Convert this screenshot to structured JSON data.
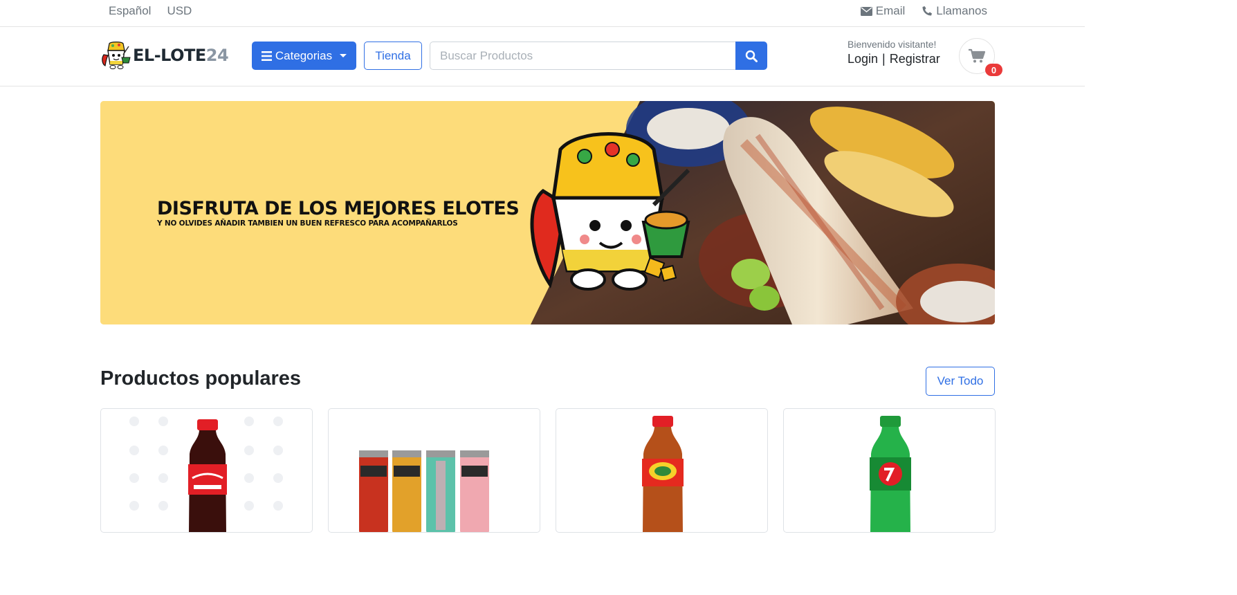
{
  "topbar": {
    "language": "Español",
    "currency": "USD",
    "email_label": "Email",
    "call_label": "Llamanos"
  },
  "header": {
    "logo_text_main": "EL-LOTE",
    "logo_text_num": "24",
    "categories_label": "Categorias",
    "store_label": "Tienda",
    "search_placeholder": "Buscar Productos",
    "welcome_text": "Bienvenido visitante!",
    "login_label": "Login",
    "separator": "|",
    "register_label": "Registrar",
    "cart_count": "0"
  },
  "banner": {
    "title": "DISFRUTA DE LOS MEJORES ELOTES",
    "subtitle": "Y NO OLVIDES AÑADIR TAMBIEN UN BUEN REFRESCO PARA ACOMPAÑARLOS"
  },
  "popular": {
    "title": "Productos populares",
    "view_all_label": "Ver Todo"
  },
  "products": [
    {
      "image": "coca-cola-bottle"
    },
    {
      "image": "arizona-cans"
    },
    {
      "image": "manzanita-sol-bottle"
    },
    {
      "image": "7up-bottle"
    }
  ],
  "colors": {
    "primary": "#2f6fe4",
    "badge": "#ea3a3a",
    "banner_bg": "#fddc7a"
  },
  "icons": [
    "bars-icon",
    "search-icon",
    "envelope-icon",
    "phone-icon",
    "cart-icon"
  ]
}
